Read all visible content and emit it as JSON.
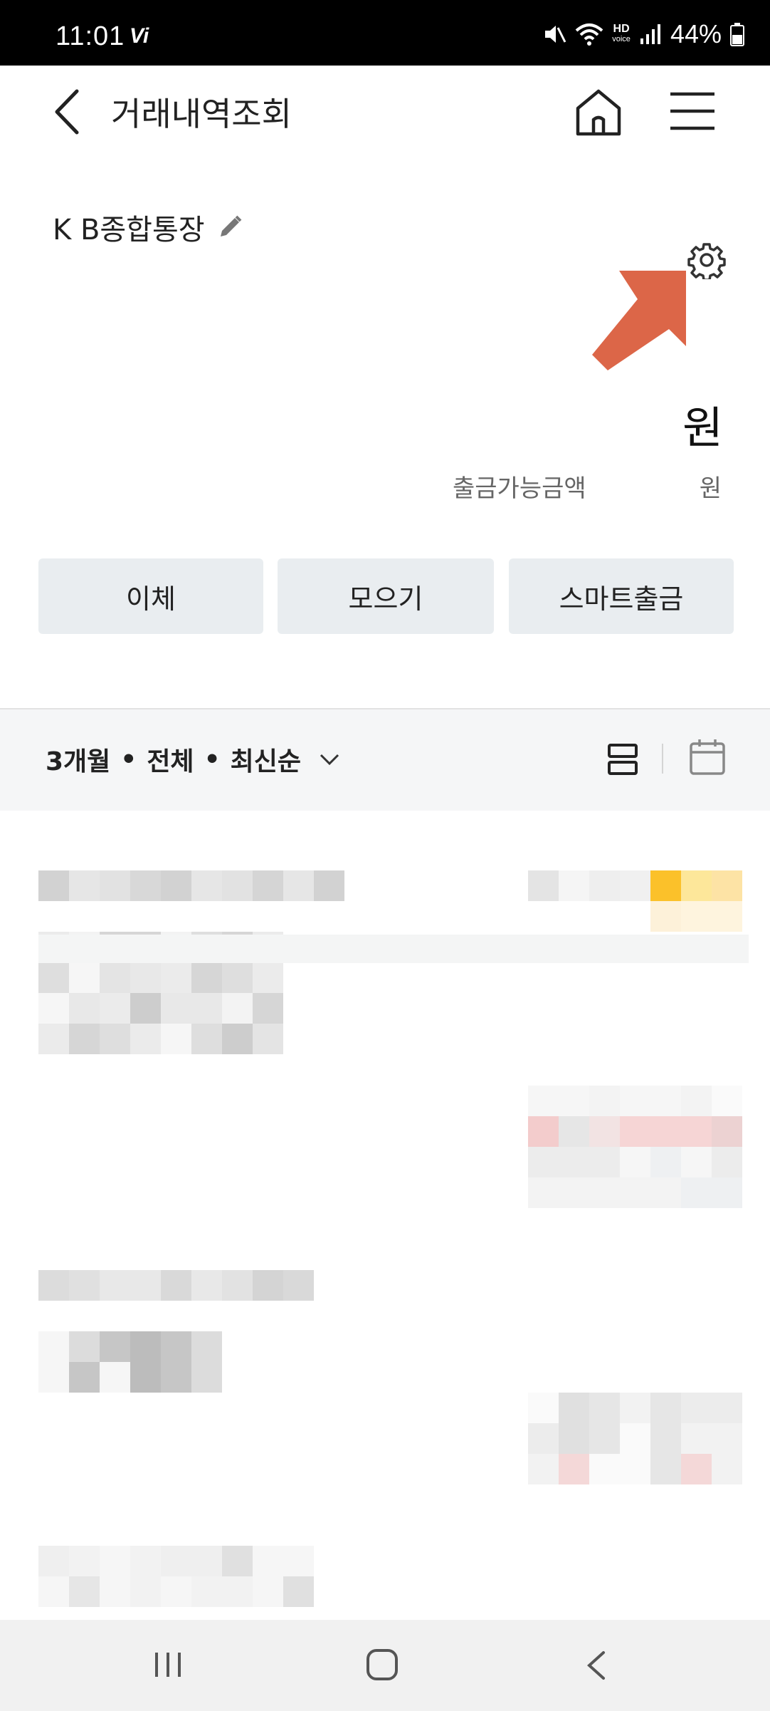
{
  "status_bar": {
    "time": "11:01",
    "carrier_icon_text": "Vi",
    "hd_label": "HD",
    "voice_label": "voice",
    "battery_percent": "44%"
  },
  "header": {
    "title": "거래내역조회",
    "icons": [
      "back-arrow-icon",
      "home-icon",
      "hamburger-menu-icon"
    ]
  },
  "account": {
    "name": "K B종합통장",
    "balance_unit": "원",
    "available_label": "출금가능금액",
    "available_unit": "원"
  },
  "actions": {
    "transfer": "이체",
    "collect": "모으기",
    "smart_withdraw": "스마트출금"
  },
  "filter": {
    "period": "3개월",
    "separator": "•",
    "type": "전체",
    "order": "최신순"
  },
  "colors": {
    "accent_arrow": "#dc6648",
    "button_bg": "#e9edf0",
    "filter_bg": "#f5f6f7",
    "status_bar_bg": "#000000"
  }
}
